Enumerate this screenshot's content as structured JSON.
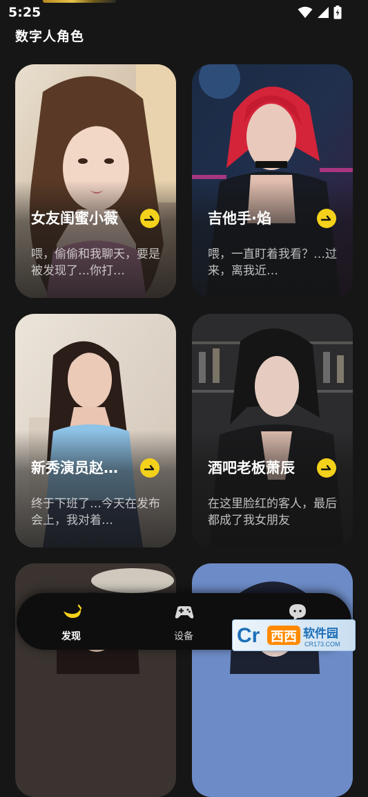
{
  "status_bar": {
    "time": "5:25"
  },
  "section_title": "数字人角色",
  "cards": [
    {
      "name": "女友闺蜜小薇",
      "desc": "喂，偷偷和我聊天，要是被发现了…你打…"
    },
    {
      "name": "吉他手·焰",
      "desc": "喂，一直盯着我看？…过来，离我近…"
    },
    {
      "name": "新秀演员赵…",
      "desc": "终于下班了…今天在发布会上，我对着…"
    },
    {
      "name": "酒吧老板萧辰",
      "desc": "在这里脸红的客人，最后都成了我女朋友"
    }
  ],
  "tab_bar": {
    "tabs": [
      {
        "label": "发现",
        "icon": "banana-icon",
        "active": true
      },
      {
        "label": "设备",
        "icon": "gamepad-icon",
        "active": false
      },
      {
        "label": "",
        "icon": "chat-bubble-icon",
        "active": false
      }
    ]
  },
  "watermark": {
    "text": "Cr 西西软件园 CR173.COM"
  },
  "colors": {
    "accent": "#f4d21b",
    "background": "#161616",
    "tab_bar": "#0e0e0e"
  }
}
